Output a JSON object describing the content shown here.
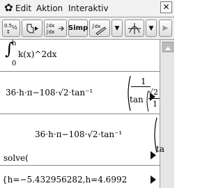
{
  "menu": {
    "items": [
      "Edit",
      "Aktion",
      "Interaktiv"
    ]
  },
  "toolbar": {
    "buttons": [
      {
        "name": "fraction-decimal-toggle",
        "label": "0.5↔½"
      },
      {
        "name": "hand-arrow-tool",
        "label": "↳▸"
      },
      {
        "name": "definite-integral-template",
        "label": "∫dx→∫dx"
      },
      {
        "name": "simplify",
        "label": "Simp"
      },
      {
        "name": "integral-edit",
        "label": "∫dx"
      },
      {
        "name": "dropdown-1",
        "label": "▼"
      },
      {
        "name": "graph-tool",
        "label": "⊬"
      },
      {
        "name": "dropdown-2",
        "label": "▼"
      },
      {
        "name": "next-tool",
        "label": "▶"
      }
    ]
  },
  "work": {
    "integral_upper": "h",
    "integral_lower": "0",
    "integral_body": "k(x)^2dx",
    "output1_prefix": "36·h·π−108·√2·tan⁻¹",
    "output1_frac_num": "1",
    "output1_frac_den": "tan",
    "output1_inner_num": "√2",
    "output1_inner_den": "1",
    "solve_expr_prefix": "36·h·π−108·√2·tan⁻¹",
    "solve_frac_den": "ta",
    "solve_label": "solve(",
    "solution": "{h=−5.432956282,h=4.6992"
  }
}
